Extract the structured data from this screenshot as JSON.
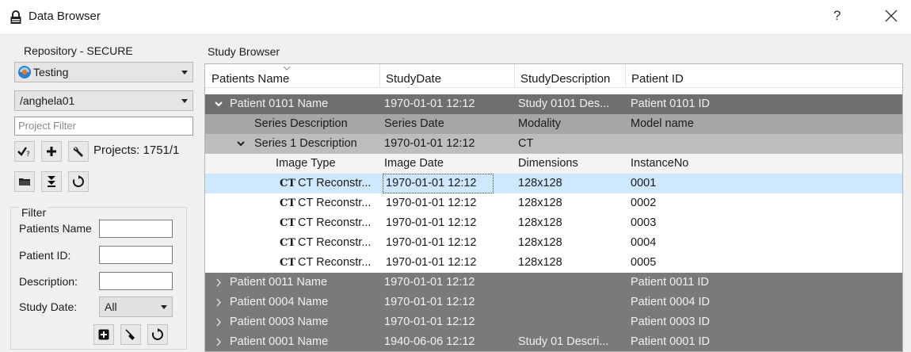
{
  "window": {
    "title": "Data Browser",
    "help_label": "?"
  },
  "repository": {
    "group_label": "Repository - SECURE",
    "server": "Testing",
    "project": "/anghela01",
    "project_filter_placeholder": "Project Filter",
    "projects_count": "Projects: 1751/1"
  },
  "filter": {
    "group_label": "Filter",
    "patients_name_label": "Patients Name",
    "patient_id_label": "Patient ID:",
    "description_label": "Description:",
    "study_date_label": "Study Date:",
    "study_date_value": "All"
  },
  "study_browser": {
    "label": "Study Browser",
    "columns": [
      "Patients Name",
      "StudyDate",
      "StudyDescription",
      "Patient ID"
    ],
    "patients": [
      {
        "name": "Patient 0101 Name",
        "date": "1970-01-01 12:12",
        "description": "Study 0101 Des...",
        "id": "Patient 0101 ID"
      },
      {
        "name": "Patient 0011 Name",
        "date": "1970-01-01 12:12",
        "description": "",
        "id": "Patient 0011 ID"
      },
      {
        "name": "Patient 0004 Name",
        "date": "1970-01-01 12:12",
        "description": "",
        "id": "Patient 0004 ID"
      },
      {
        "name": "Patient 0003 Name",
        "date": "1970-01-01 12:12",
        "description": "",
        "id": "Patient 0003 ID"
      },
      {
        "name": "Patient 0001 Name",
        "date": "1940-06-06 12:12",
        "description": "Study 01 Descri...",
        "id": "Patient 0001 ID"
      }
    ],
    "series_columns": [
      "Series Description",
      "Series Date",
      "Modality",
      "Model name"
    ],
    "series": {
      "description": "Series 1 Description",
      "date": "1970-01-01 12:12",
      "modality": "CT",
      "model": ""
    },
    "image_columns": [
      "Image Type",
      "Image Date",
      "Dimensions",
      "InstanceNo"
    ],
    "images": [
      {
        "icon": "CT",
        "type": "CT Reconstr...",
        "date": "1970-01-01 12:12",
        "dimensions": "128x128",
        "instance": "0001"
      },
      {
        "icon": "CT",
        "type": "CT Reconstr...",
        "date": "1970-01-01 12:12",
        "dimensions": "128x128",
        "instance": "0002"
      },
      {
        "icon": "CT",
        "type": "CT Reconstr...",
        "date": "1970-01-01 12:12",
        "dimensions": "128x128",
        "instance": "0003"
      },
      {
        "icon": "CT",
        "type": "CT Reconstr...",
        "date": "1970-01-01 12:12",
        "dimensions": "128x128",
        "instance": "0004"
      },
      {
        "icon": "CT",
        "type": "CT Reconstr...",
        "date": "1970-01-01 12:12",
        "dimensions": "128x128",
        "instance": "0005"
      }
    ]
  },
  "colors": {
    "patient_row": "#7a7a7a",
    "series_header_row": "#a6a6a6",
    "series_row": "#bdbdbd",
    "selected_row": "#cde8ff"
  }
}
